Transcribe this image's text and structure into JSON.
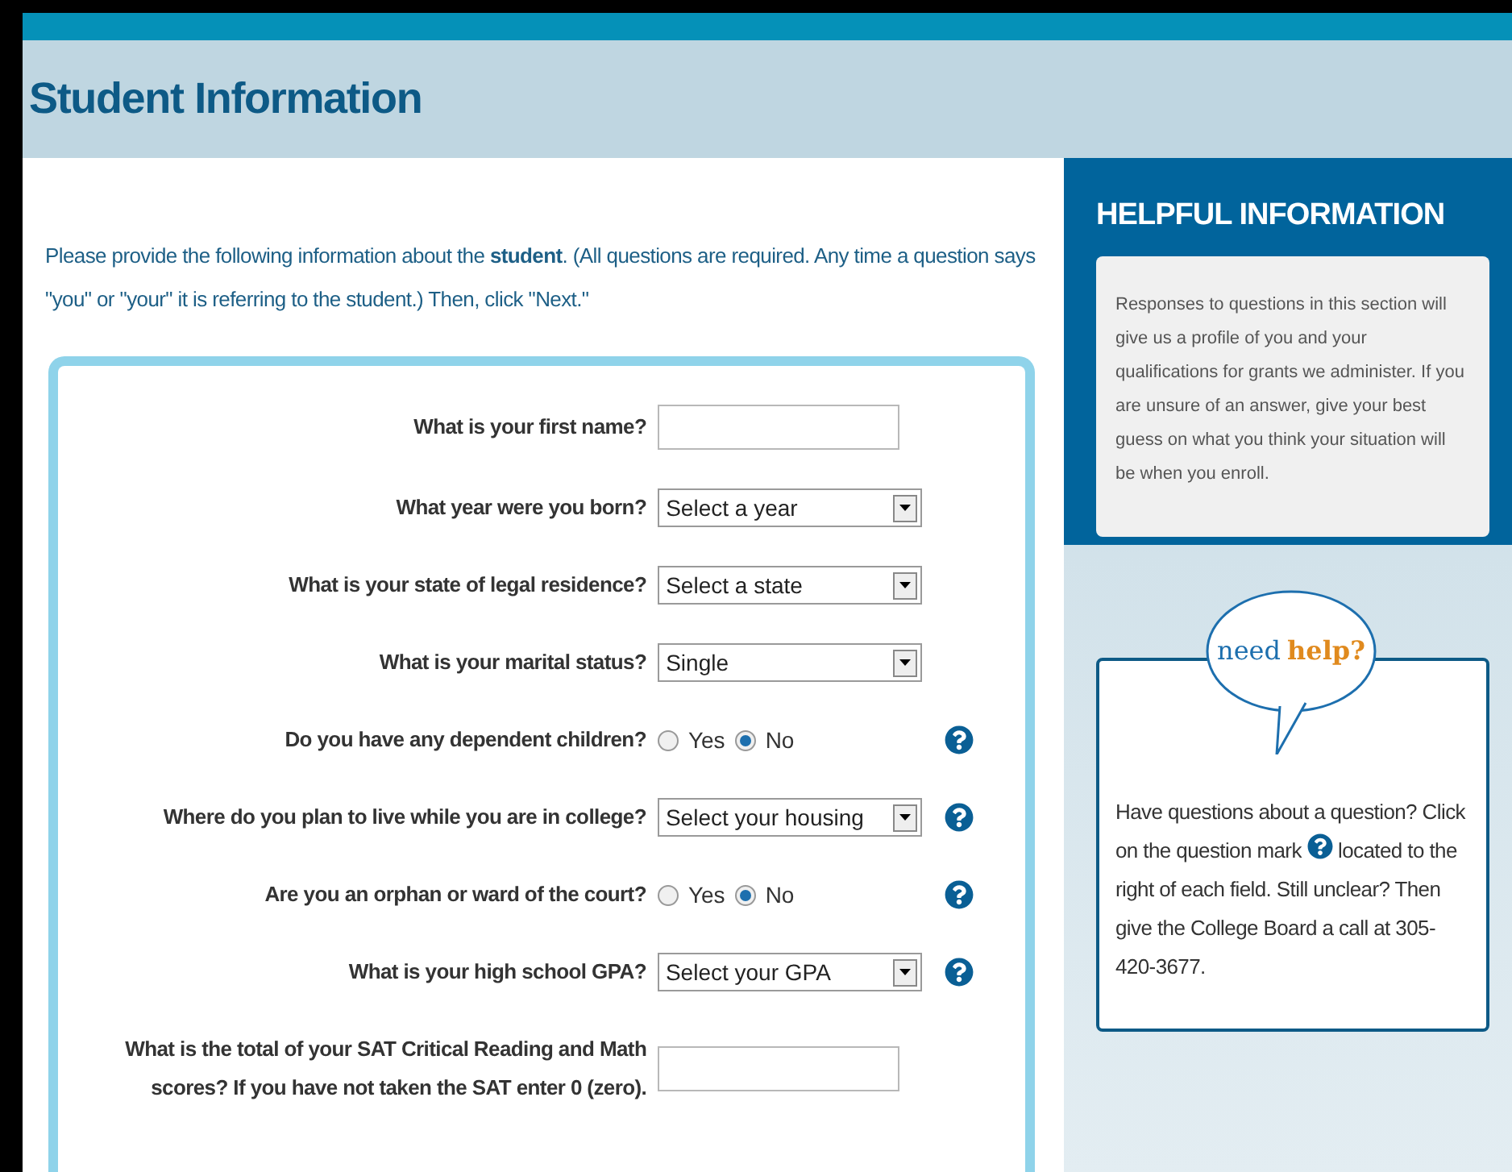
{
  "page": {
    "title": "Student Information"
  },
  "intro": "Please provide the following information about the **student**. (All questions are required. Any time a question says \"you\" or \"your\" it is referring to the student.) Then, click \"Next.\"",
  "questions": [
    {
      "label": "What is your first name?",
      "kind": "text",
      "help": false
    },
    {
      "label": "What year were you born?",
      "kind": "select",
      "value": "Select a year",
      "help": false
    },
    {
      "label": "What is your state of legal residence?",
      "kind": "select",
      "value": "Select a state",
      "help": false
    },
    {
      "label": "What is your marital status?",
      "kind": "select",
      "value": "Single",
      "help": false
    },
    {
      "label": "Do you have any dependent children?",
      "kind": "radio",
      "options": [
        {
          "label": "Yes",
          "selected": false
        },
        {
          "label": "No",
          "selected": true
        }
      ],
      "help": true
    },
    {
      "label": "Where do you plan to live while you are in college?",
      "kind": "select",
      "value": "Select your housing",
      "help": true
    },
    {
      "label": "Are you an orphan or ward of the court?",
      "kind": "radio",
      "options": [
        {
          "label": "Yes",
          "selected": false
        },
        {
          "label": "No",
          "selected": true
        }
      ],
      "help": true
    },
    {
      "label": "What is your high school GPA?",
      "kind": "select",
      "value": "Select your GPA",
      "help": true
    },
    {
      "label": "What is the total of your SAT Critical Reading and Math scores? If you have not taken the SAT enter 0 (zero).",
      "kind": "text",
      "help": false
    }
  ],
  "helpful_information": {
    "title": "HELPFUL INFORMATION",
    "text": "Responses to questions in this section will give us a profile of you and your qualifications for grants we administer. If you are unsure of an answer, give your best guess on what you think your situation will be when you enroll."
  },
  "need_help": {
    "title_1": "need",
    "title_2": "help?",
    "text_before": "Have questions about a question? Click on the question mark",
    "text_after": "located to the right of each field. Still unclear? Then give the College Board a call at 305-420-3677."
  }
}
